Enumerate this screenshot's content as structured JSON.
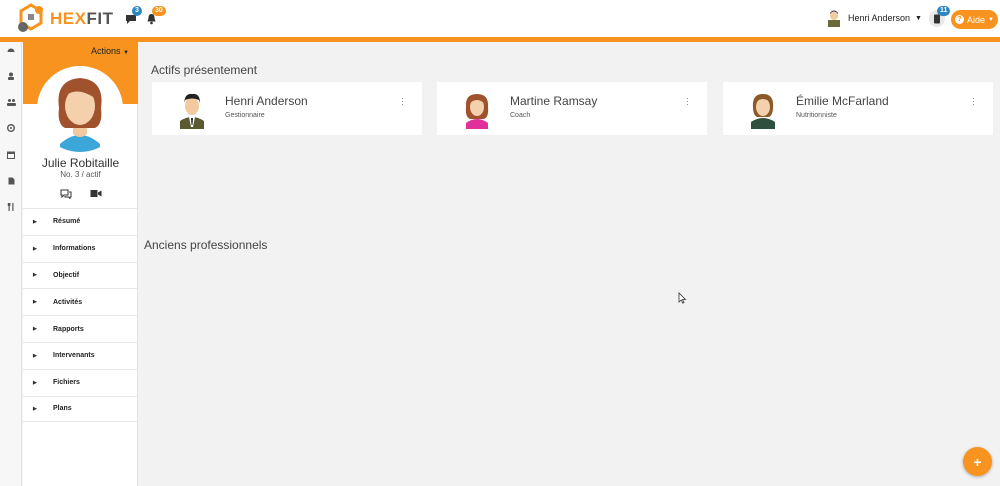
{
  "header": {
    "logo": {
      "text_a": "HEX",
      "text_b": "FIT"
    },
    "chat_badge": "3",
    "bell_badge": "30",
    "user_name": "Henri Anderson",
    "phone_badge": "11",
    "help_label": "Aide"
  },
  "rail": {
    "icons": [
      "dashboard-icon",
      "user-icon",
      "users-icon",
      "target-icon",
      "calendar-icon",
      "file-icon",
      "utensils-icon"
    ]
  },
  "profile": {
    "actions_label": "Actions",
    "name": "Julie Robitaille",
    "subtitle": "No. 3 / actif",
    "menu": [
      "Résumé",
      "Informations",
      "Objectif",
      "Activités",
      "Rapports",
      "Intervenants",
      "Fichiers",
      "Plans"
    ]
  },
  "main": {
    "active_title": "Actifs présentement",
    "former_title": "Anciens professionnels",
    "cards": [
      {
        "name": "Henri Anderson",
        "role": "Gestionnaire"
      },
      {
        "name": "Martine Ramsay",
        "role": "Coach"
      },
      {
        "name": "Émilie McFarland",
        "role": "Nutritionniste"
      }
    ],
    "fab_label": "+"
  },
  "colors": {
    "accent": "#f7931e",
    "badge_blue": "#2e86c1"
  }
}
